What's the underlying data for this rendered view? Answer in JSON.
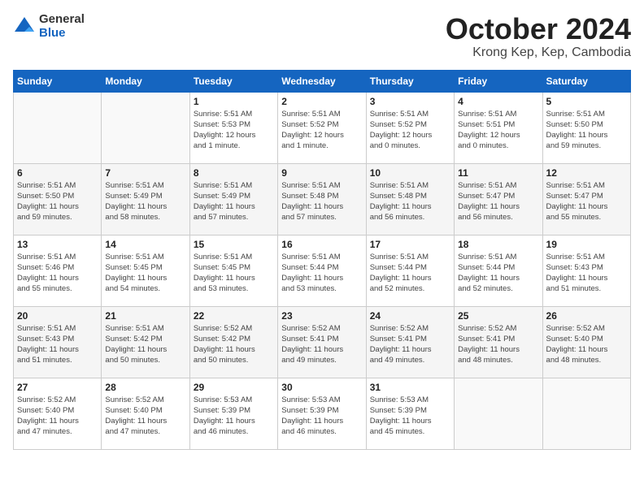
{
  "header": {
    "logo_general": "General",
    "logo_blue": "Blue",
    "month_title": "October 2024",
    "location": "Krong Kep, Kep, Cambodia"
  },
  "weekdays": [
    "Sunday",
    "Monday",
    "Tuesday",
    "Wednesday",
    "Thursday",
    "Friday",
    "Saturday"
  ],
  "weeks": [
    [
      {
        "day": "",
        "detail": ""
      },
      {
        "day": "",
        "detail": ""
      },
      {
        "day": "1",
        "detail": "Sunrise: 5:51 AM\nSunset: 5:53 PM\nDaylight: 12 hours\nand 1 minute."
      },
      {
        "day": "2",
        "detail": "Sunrise: 5:51 AM\nSunset: 5:52 PM\nDaylight: 12 hours\nand 1 minute."
      },
      {
        "day": "3",
        "detail": "Sunrise: 5:51 AM\nSunset: 5:52 PM\nDaylight: 12 hours\nand 0 minutes."
      },
      {
        "day": "4",
        "detail": "Sunrise: 5:51 AM\nSunset: 5:51 PM\nDaylight: 12 hours\nand 0 minutes."
      },
      {
        "day": "5",
        "detail": "Sunrise: 5:51 AM\nSunset: 5:50 PM\nDaylight: 11 hours\nand 59 minutes."
      }
    ],
    [
      {
        "day": "6",
        "detail": "Sunrise: 5:51 AM\nSunset: 5:50 PM\nDaylight: 11 hours\nand 59 minutes."
      },
      {
        "day": "7",
        "detail": "Sunrise: 5:51 AM\nSunset: 5:49 PM\nDaylight: 11 hours\nand 58 minutes."
      },
      {
        "day": "8",
        "detail": "Sunrise: 5:51 AM\nSunset: 5:49 PM\nDaylight: 11 hours\nand 57 minutes."
      },
      {
        "day": "9",
        "detail": "Sunrise: 5:51 AM\nSunset: 5:48 PM\nDaylight: 11 hours\nand 57 minutes."
      },
      {
        "day": "10",
        "detail": "Sunrise: 5:51 AM\nSunset: 5:48 PM\nDaylight: 11 hours\nand 56 minutes."
      },
      {
        "day": "11",
        "detail": "Sunrise: 5:51 AM\nSunset: 5:47 PM\nDaylight: 11 hours\nand 56 minutes."
      },
      {
        "day": "12",
        "detail": "Sunrise: 5:51 AM\nSunset: 5:47 PM\nDaylight: 11 hours\nand 55 minutes."
      }
    ],
    [
      {
        "day": "13",
        "detail": "Sunrise: 5:51 AM\nSunset: 5:46 PM\nDaylight: 11 hours\nand 55 minutes."
      },
      {
        "day": "14",
        "detail": "Sunrise: 5:51 AM\nSunset: 5:45 PM\nDaylight: 11 hours\nand 54 minutes."
      },
      {
        "day": "15",
        "detail": "Sunrise: 5:51 AM\nSunset: 5:45 PM\nDaylight: 11 hours\nand 53 minutes."
      },
      {
        "day": "16",
        "detail": "Sunrise: 5:51 AM\nSunset: 5:44 PM\nDaylight: 11 hours\nand 53 minutes."
      },
      {
        "day": "17",
        "detail": "Sunrise: 5:51 AM\nSunset: 5:44 PM\nDaylight: 11 hours\nand 52 minutes."
      },
      {
        "day": "18",
        "detail": "Sunrise: 5:51 AM\nSunset: 5:44 PM\nDaylight: 11 hours\nand 52 minutes."
      },
      {
        "day": "19",
        "detail": "Sunrise: 5:51 AM\nSunset: 5:43 PM\nDaylight: 11 hours\nand 51 minutes."
      }
    ],
    [
      {
        "day": "20",
        "detail": "Sunrise: 5:51 AM\nSunset: 5:43 PM\nDaylight: 11 hours\nand 51 minutes."
      },
      {
        "day": "21",
        "detail": "Sunrise: 5:51 AM\nSunset: 5:42 PM\nDaylight: 11 hours\nand 50 minutes."
      },
      {
        "day": "22",
        "detail": "Sunrise: 5:52 AM\nSunset: 5:42 PM\nDaylight: 11 hours\nand 50 minutes."
      },
      {
        "day": "23",
        "detail": "Sunrise: 5:52 AM\nSunset: 5:41 PM\nDaylight: 11 hours\nand 49 minutes."
      },
      {
        "day": "24",
        "detail": "Sunrise: 5:52 AM\nSunset: 5:41 PM\nDaylight: 11 hours\nand 49 minutes."
      },
      {
        "day": "25",
        "detail": "Sunrise: 5:52 AM\nSunset: 5:41 PM\nDaylight: 11 hours\nand 48 minutes."
      },
      {
        "day": "26",
        "detail": "Sunrise: 5:52 AM\nSunset: 5:40 PM\nDaylight: 11 hours\nand 48 minutes."
      }
    ],
    [
      {
        "day": "27",
        "detail": "Sunrise: 5:52 AM\nSunset: 5:40 PM\nDaylight: 11 hours\nand 47 minutes."
      },
      {
        "day": "28",
        "detail": "Sunrise: 5:52 AM\nSunset: 5:40 PM\nDaylight: 11 hours\nand 47 minutes."
      },
      {
        "day": "29",
        "detail": "Sunrise: 5:53 AM\nSunset: 5:39 PM\nDaylight: 11 hours\nand 46 minutes."
      },
      {
        "day": "30",
        "detail": "Sunrise: 5:53 AM\nSunset: 5:39 PM\nDaylight: 11 hours\nand 46 minutes."
      },
      {
        "day": "31",
        "detail": "Sunrise: 5:53 AM\nSunset: 5:39 PM\nDaylight: 11 hours\nand 45 minutes."
      },
      {
        "day": "",
        "detail": ""
      },
      {
        "day": "",
        "detail": ""
      }
    ]
  ]
}
